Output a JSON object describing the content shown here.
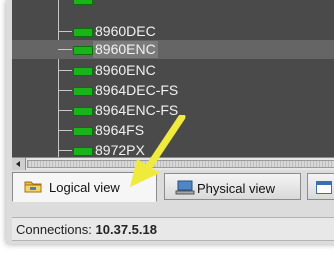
{
  "tree": {
    "items": [
      {
        "label": "8960DEC",
        "selected": false
      },
      {
        "label": "8960ENC",
        "selected": true
      },
      {
        "label": "8960ENC",
        "selected": false
      },
      {
        "label": "8964DEC-FS",
        "selected": false
      },
      {
        "label": "8964ENC-FS",
        "selected": false
      },
      {
        "label": "8964FS",
        "selected": false
      },
      {
        "label": "8972PX",
        "selected": false
      }
    ]
  },
  "tabs": {
    "logical": "Logical view",
    "physical": "Physical view"
  },
  "status": {
    "label": "Connections:",
    "value": "10.37.5.18"
  },
  "colors": {
    "tree_background": "#4a4a4a",
    "device_icon": "#19b419",
    "callout_arrow": "#f0ea3c"
  }
}
